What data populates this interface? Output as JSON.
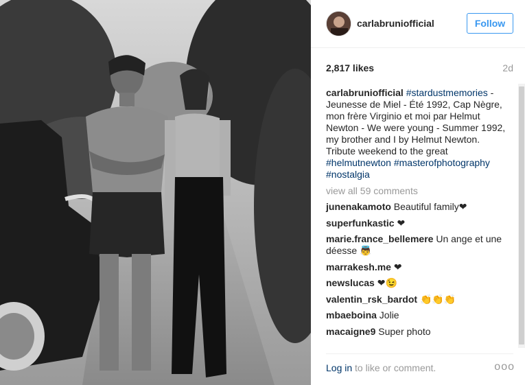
{
  "post": {
    "username": "carlabruniofficial",
    "follow_label": "Follow",
    "likes": "2,817 likes",
    "age": "2d",
    "caption": {
      "username": "carlabruniofficial",
      "hashtag1": "#stardustmemories",
      "text1": " - Jeunesse de Miel - Été 1992, Cap Nègre, mon frère Virginio et moi par Helmut Newton - We were young - Summer 1992, my brother and I by Helmut Newton. Tribute weekend to the great ",
      "hashtag2": "#helmutnewton",
      "hashtag3": "#masterofphotography",
      "hashtag4": "#nostalgia"
    },
    "view_all": "view all 59 comments",
    "comments": [
      {
        "user": "junenakamoto",
        "text": "Beautiful family❤"
      },
      {
        "user": "superfunkastic",
        "text": "❤"
      },
      {
        "user": "marie.france_bellemere",
        "text": "Un ange et une déesse 👼"
      },
      {
        "user": "marrakesh.me",
        "text": "❤"
      },
      {
        "user": "newslucas",
        "text": "❤😉"
      },
      {
        "user": "valentin_rsk_bardot",
        "text": "👏👏👏"
      },
      {
        "user": "mbaeboina",
        "text": "Jolie"
      },
      {
        "user": "macaigne9",
        "text": "Super photo"
      }
    ],
    "login_link": "Log in",
    "login_rest": " to like or comment.",
    "more_icon": "ooo"
  },
  "colors": {
    "link": "#003569",
    "follow": "#3897f0",
    "muted": "#999999"
  }
}
